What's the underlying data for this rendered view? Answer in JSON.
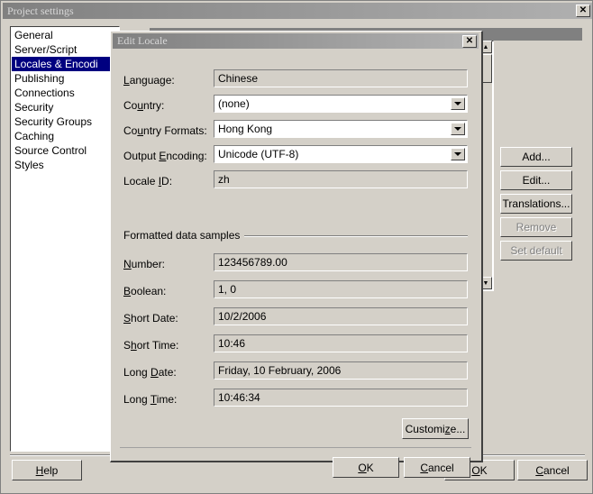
{
  "main_window": {
    "title": "Project settings",
    "close_button": "✕",
    "sidebar": {
      "items": [
        {
          "label": "General",
          "selected": false
        },
        {
          "label": "Server/Script",
          "selected": false
        },
        {
          "label": "Locales & Encodi",
          "selected": true
        },
        {
          "label": "Publishing",
          "selected": false
        },
        {
          "label": "Connections",
          "selected": false
        },
        {
          "label": "Security",
          "selected": false
        },
        {
          "label": "Security Groups",
          "selected": false
        },
        {
          "label": "Caching",
          "selected": false
        },
        {
          "label": "Source Control",
          "selected": false
        },
        {
          "label": "Styles",
          "selected": false
        }
      ]
    },
    "side_buttons": [
      {
        "label": "Add...",
        "disabled": false
      },
      {
        "label": "Edit...",
        "disabled": false
      },
      {
        "label": "Translations...",
        "disabled": false
      },
      {
        "label": "Remove",
        "disabled": true
      },
      {
        "label": "Set default",
        "disabled": true
      }
    ],
    "bottom_buttons": {
      "help": "Help",
      "ok": "OK",
      "cancel": "Cancel"
    }
  },
  "dialog": {
    "title": "Edit Locale",
    "close_button": "✕",
    "fields": [
      {
        "label": "Language:",
        "accel": "L",
        "value": "Chinese",
        "type": "readonly"
      },
      {
        "label": "Country:",
        "accel": "u",
        "value": "(none)",
        "type": "combo"
      },
      {
        "label": "Country Formats:",
        "accel": "u",
        "value": "Hong Kong",
        "type": "combo"
      },
      {
        "label": "Output Encoding:",
        "accel": "E",
        "value": "Unicode (UTF-8)",
        "type": "combo"
      },
      {
        "label": "Locale ID:",
        "accel": "I",
        "value": "zh",
        "type": "readonly"
      }
    ],
    "group": {
      "title": "Formatted data samples",
      "samples": [
        {
          "label": "Number:",
          "accel": "N",
          "value": "123456789.00"
        },
        {
          "label": "Boolean:",
          "accel": "B",
          "value": "1, 0"
        },
        {
          "label": "Short Date:",
          "accel": "S",
          "value": "10/2/2006"
        },
        {
          "label": "Short Time:",
          "accel": "h",
          "value": "10:46"
        },
        {
          "label": "Long Date:",
          "accel": "D",
          "value": "Friday, 10 February, 2006"
        },
        {
          "label": "Long Time:",
          "accel": "T",
          "value": "10:46:34"
        }
      ]
    },
    "customize_button": "Customize...",
    "ok_button": "OK",
    "cancel_button": "Cancel"
  },
  "colors": {
    "face": "#d4d0c8",
    "selection": "#000080",
    "titlebar_inactive_start": "#808080",
    "titlebar_inactive_end": "#b2b2b2",
    "window_bg": "#ffffff",
    "disabled_text": "#808080"
  }
}
